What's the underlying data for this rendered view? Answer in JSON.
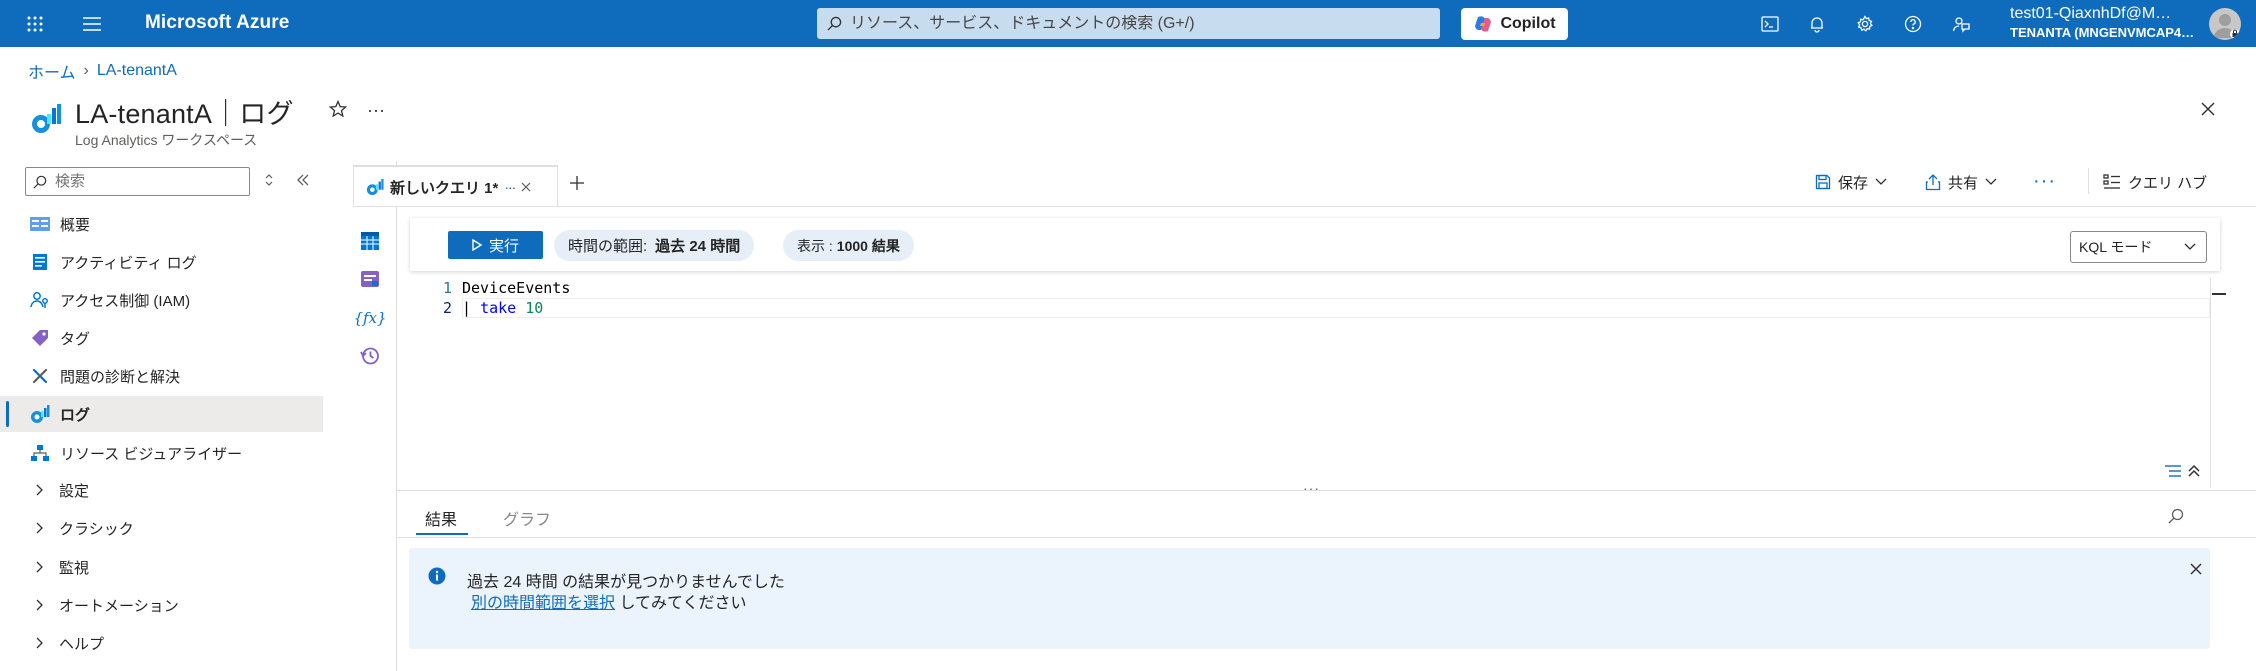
{
  "topbar": {
    "brand": "Microsoft Azure",
    "search_placeholder": "リソース、サービス、ドキュメントの検索 (G+/)",
    "copilot_label": "Copilot",
    "user_name": "test01-QiaxnhDf@M…",
    "tenant": "TENANTA (MNGENVMCAP4…"
  },
  "breadcrumb": {
    "home": "ホーム",
    "current": "LA-tenantA"
  },
  "resource": {
    "title": "LA-tenantA｜ログ",
    "subtitle": "Log Analytics ワークスペース"
  },
  "sidebar": {
    "search_placeholder": "検索",
    "items": [
      {
        "label": "概要",
        "icon": "overview-icon"
      },
      {
        "label": "アクティビティ ログ",
        "icon": "activity-log-icon"
      },
      {
        "label": "アクセス制御 (IAM)",
        "icon": "iam-icon"
      },
      {
        "label": "タグ",
        "icon": "tag-icon"
      },
      {
        "label": "問題の診断と解決",
        "icon": "diagnose-icon"
      },
      {
        "label": "ログ",
        "icon": "logs-icon"
      },
      {
        "label": "リソース ビジュアライザー",
        "icon": "visualizer-icon"
      }
    ],
    "groups": [
      "設定",
      "クラシック",
      "監視",
      "オートメーション",
      "ヘルプ"
    ]
  },
  "query_tab": {
    "label": "新しいクエリ 1*"
  },
  "toolbar": {
    "save": "保存",
    "share": "共有",
    "query_hub": "クエリ ハブ"
  },
  "query_bar": {
    "run": "実行",
    "time_range_label": "時間の範囲:",
    "time_range_value": "過去 24 時間",
    "show_label": "表示 :",
    "show_value": "1000 結果",
    "mode": "KQL モード"
  },
  "editor": {
    "lines": [
      {
        "no": "1",
        "text": "DeviceEvents"
      },
      {
        "no": "2",
        "pipe": "| ",
        "kw": "take",
        "num": "10"
      }
    ]
  },
  "results": {
    "tabs": [
      "結果",
      "グラフ"
    ],
    "message_line1": "過去 24 時間 の結果が見つかりませんでした",
    "message_link": "別の時間範囲を選択",
    "message_tail": " してみてください"
  },
  "colors": {
    "accent": "#0f6cbd",
    "topbar": "#0f6cbd"
  }
}
